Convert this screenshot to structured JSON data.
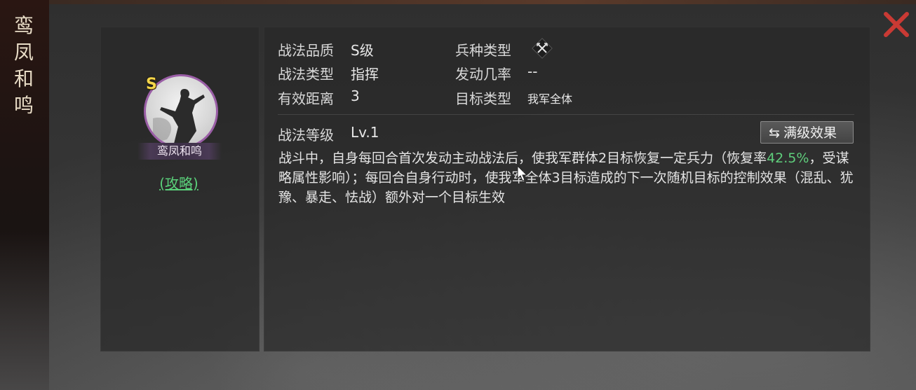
{
  "window": {
    "vertical_title_chars": [
      "鸾",
      "凤",
      "和",
      "鸣"
    ],
    "close_icon": "close-x-icon",
    "accent_red": "#c93a34"
  },
  "skill_card": {
    "grade": "S",
    "name": "鸾凤和鸣",
    "guide_link": "(攻略)",
    "portrait_border_color": "#9a5ea6"
  },
  "attributes": {
    "quality_label": "战法品质",
    "quality_value": "S级",
    "unit_type_label": "兵种类型",
    "unit_type_icon": "crossed-weapons-icon",
    "type_label": "战法类型",
    "type_value": "指挥",
    "trigger_rate_label": "发动几率",
    "trigger_rate_value": "--",
    "range_label": "有效距离",
    "range_value": "3",
    "target_label": "目标类型",
    "target_value": "我军全体"
  },
  "level": {
    "label": "战法等级",
    "value": "Lv.1",
    "max_button_label": "满级效果"
  },
  "description": {
    "part1": "战斗中，自身每回合首次发动主动战法后，使我军群体2目标恢复一定兵力（恢复率",
    "highlight1": "42.5%",
    "part2": "，受谋略属性影响）；每回合自身行动时，使我军全体3目标造成的下一次随机目标的控制效果（混乱、犹豫、暴走、怯战）额外对一个目标生效",
    "highlight_color": "#5fce7c"
  }
}
